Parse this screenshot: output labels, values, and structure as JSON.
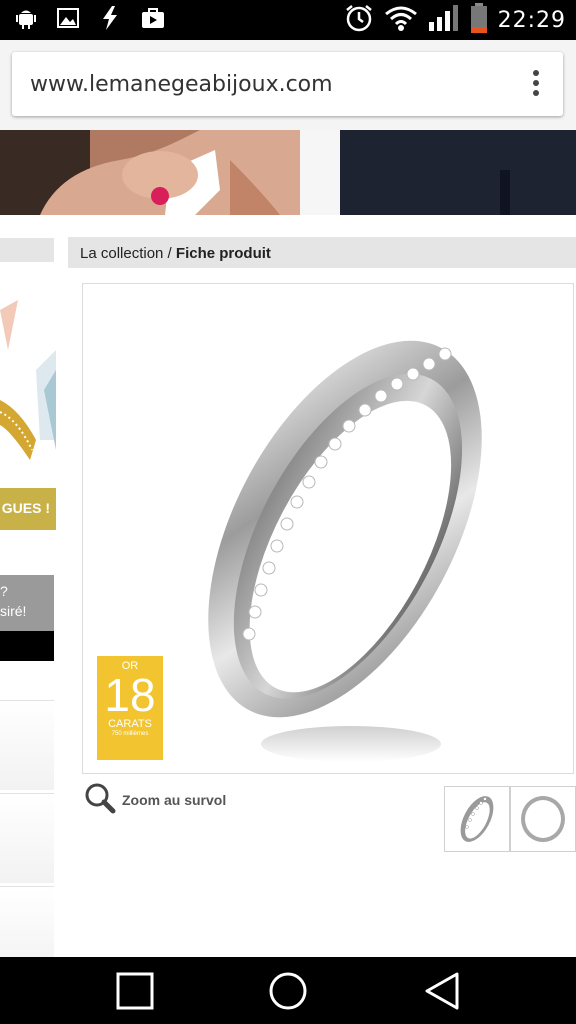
{
  "status_bar": {
    "time": "22:29",
    "left_icons": [
      "android-debug-icon",
      "image-icon",
      "flash-icon",
      "play-store-icon"
    ],
    "right_icons": [
      "alarm-icon",
      "wifi-icon",
      "signal-icon",
      "battery-icon"
    ]
  },
  "browser": {
    "url": "www.lemanegeabijoux.com",
    "menu_icon": "overflow-menu-icon"
  },
  "sidebar": {
    "banner_text": "GUES !",
    "gray_box_line1": "?",
    "gray_box_line2": "siré!"
  },
  "breadcrumb": {
    "collection": "La collection /",
    "current": "Fiche produit"
  },
  "product": {
    "badge": {
      "or": "OR",
      "number": "18",
      "carats": "CARATS",
      "millesimes": "750 millièmes"
    },
    "zoom_label": "Zoom au survol",
    "thumbnails": [
      "ring-diamond-thumb",
      "ring-plain-thumb"
    ]
  },
  "colors": {
    "status_bar": "#000000",
    "breadcrumb_bg": "#e5e5e5",
    "badge_gold": "#f2c530",
    "sidebar_gold": "#c8b146"
  },
  "nav_bar": {
    "buttons": [
      "recent-apps-icon",
      "home-icon",
      "back-icon"
    ]
  }
}
